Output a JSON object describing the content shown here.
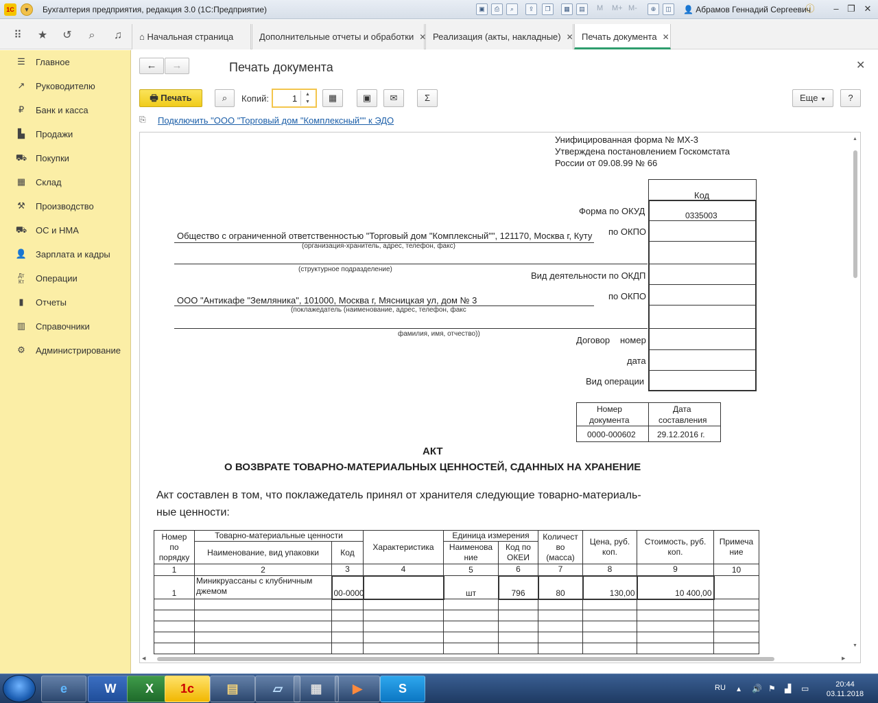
{
  "window": {
    "title": "Бухгалтерия предприятия, редакция 3.0 (1С:Предприятие)",
    "app_logo": "1С",
    "user": "Абрамов Геннадий Сергеевич",
    "toolbar_icons": [
      "save-icon",
      "print-icon",
      "preview-icon",
      "upload-icon",
      "copy-icon",
      "calculator-icon",
      "calendar-icon",
      "zoom-icon",
      "panel-icon"
    ],
    "memory_buttons": [
      "M",
      "M+",
      "M-"
    ]
  },
  "tabs": [
    {
      "label": "Начальная страница",
      "icon": "home-icon"
    },
    {
      "label": "Дополнительные отчеты и обработки"
    },
    {
      "label": "Реализация (акты, накладные)"
    },
    {
      "label": "Печать документа"
    }
  ],
  "sidebar": {
    "items": [
      {
        "label": "Главное",
        "icon": "menu-icon"
      },
      {
        "label": "Руководителю",
        "icon": "trend-icon"
      },
      {
        "label": "Банк и касса",
        "icon": "ruble-icon"
      },
      {
        "label": "Продажи",
        "icon": "bag-icon"
      },
      {
        "label": "Покупки",
        "icon": "cart-icon"
      },
      {
        "label": "Склад",
        "icon": "warehouse-icon"
      },
      {
        "label": "Производство",
        "icon": "factory-icon"
      },
      {
        "label": "ОС и НМА",
        "icon": "truck-icon"
      },
      {
        "label": "Зарплата и кадры",
        "icon": "person-icon"
      },
      {
        "label": "Операции",
        "icon": "dt-kt-icon"
      },
      {
        "label": "Отчеты",
        "icon": "bar-chart-icon"
      },
      {
        "label": "Справочники",
        "icon": "book-icon"
      },
      {
        "label": "Администрирование",
        "icon": "gear-icon"
      }
    ]
  },
  "form": {
    "title": "Печать документа",
    "print_label": "Печать",
    "copies_label": "Копий:",
    "copies_value": "1",
    "more_label": "Еще",
    "help_label": "?",
    "sum_label": "Σ",
    "edo_link": "Подключить \"ООО \"Торговый дом \"Комплексный\"\" к ЭДО"
  },
  "document": {
    "form_header": [
      "Унифицированная форма № МХ-3",
      "Утверждена постановлением Госкомстата",
      "России от 09.08.99 № 66"
    ],
    "code_header": "Код",
    "okud_label": "Форма по ОКУД",
    "okud_value": "0335003",
    "okpo_label": "по ОКПО",
    "okdp_label": "Вид деятельности по ОКДП",
    "contract_label": "Договор",
    "number_label": "номер",
    "date_label": "дата",
    "operation_label": "Вид операции",
    "keeper": "Общество с ограниченной ответственностью \"Торговый дом \"Комплексный\"\", 121170, Москва г, Куту",
    "keeper_caption": "(организация-хранитель, адрес, телефон, факс)",
    "division_caption": "(структурное подразделение)",
    "depositor": "ООО \"Антикафе \"Земляника\", 101000, Москва г, Мясницкая ул, дом № 3",
    "depositor_caption": "(поклажедатель (наименование, адрес, телефон, факс",
    "fio_caption": "фамилия, имя, отчество))",
    "docnum_header": [
      "Номер",
      "документа"
    ],
    "docdate_header": [
      "Дата",
      "составления"
    ],
    "doc_number": "0000-000602",
    "doc_date": "29.12.2016 г.",
    "act_title": "АКТ",
    "act_subtitle": "О ВОЗВРАТЕ ТОВАРНО-МАТЕРИАЛЬНЫХ ЦЕННОСТЕЙ, СДАННЫХ НА ХРАНЕНИЕ",
    "intro_1": "Акт составлен в том, что поклажедатель принял от хранителя следующие товарно-материаль-",
    "intro_2": "ные ценности:",
    "table": {
      "h_num": [
        "Номер",
        "по",
        "порядку"
      ],
      "h_tmc": "Товарно-материальные ценности",
      "h_name": "Наименование, вид упаковки",
      "h_code": "Код",
      "h_char": "Характеристика",
      "h_unit": "Единица измерения",
      "h_unit_name": [
        "Наименова",
        "ние"
      ],
      "h_okei": [
        "Код по",
        "ОКЕИ"
      ],
      "h_qty": [
        "Количест",
        "во",
        "(масса)"
      ],
      "h_price": [
        "Цена, руб.",
        "коп."
      ],
      "h_cost": [
        "Стоимость, руб.",
        "коп."
      ],
      "h_note": [
        "Примеча",
        "ние"
      ],
      "col_numbers": [
        "1",
        "2",
        "3",
        "4",
        "5",
        "6",
        "7",
        "8",
        "9",
        "10"
      ],
      "rows": [
        {
          "num": "1",
          "name": "Миникруассаны с клубничным джемом",
          "code": "00-0000",
          "char": "",
          "unit": "шт",
          "okei": "796",
          "qty": "80",
          "price": "130,00",
          "cost": "10 400,00",
          "note": ""
        }
      ]
    }
  },
  "taskbar": {
    "apps": [
      "ie",
      "word",
      "excel",
      "1c",
      "explorer",
      "notepad",
      "calculator",
      "media",
      "skype"
    ],
    "lang": "RU",
    "time": "20:44",
    "date": "03.11.2018"
  },
  "colors": {
    "sidebar": "#fbeea6",
    "print_button": "#f0cb1b",
    "active_tab": "#2e9d6d",
    "link": "#1b5ea8"
  }
}
